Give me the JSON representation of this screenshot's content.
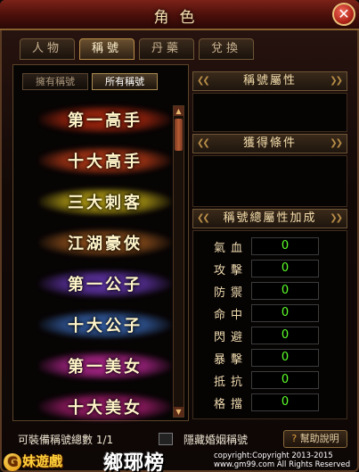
{
  "window": {
    "title": "角色",
    "close_icon": "close-icon"
  },
  "tabs": [
    {
      "label": "人物",
      "active": false
    },
    {
      "label": "稱號",
      "active": true
    },
    {
      "label": "丹藥",
      "active": false
    },
    {
      "label": "兌換",
      "active": false
    }
  ],
  "subtabs": [
    {
      "label": "擁有稱號",
      "active": false
    },
    {
      "label": "所有稱號",
      "active": true
    }
  ],
  "titles": [
    {
      "text": "第一高手",
      "glow": "#b52a10"
    },
    {
      "text": "十大高手",
      "glow": "#c8401a"
    },
    {
      "text": "三大刺客",
      "glow": "#c8b018"
    },
    {
      "text": "江湖豪俠",
      "glow": "#a05a20"
    },
    {
      "text": "第一公子",
      "glow": "#6a3ab8"
    },
    {
      "text": "十大公子",
      "glow": "#3a6ab8"
    },
    {
      "text": "第一美女",
      "glow": "#c02a9a"
    },
    {
      "text": "十大美女",
      "glow": "#b02078"
    }
  ],
  "right": {
    "title_attr_header": "稱號屬性",
    "conditions_header": "獲得條件",
    "total_attr_header": "稱號總屬性加成",
    "attributes": [
      {
        "label": "氣血",
        "value": "0"
      },
      {
        "label": "攻擊",
        "value": "0"
      },
      {
        "label": "防禦",
        "value": "0"
      },
      {
        "label": "命中",
        "value": "0"
      },
      {
        "label": "閃避",
        "value": "0"
      },
      {
        "label": "暴擊",
        "value": "0"
      },
      {
        "label": "抵抗",
        "value": "0"
      },
      {
        "label": "格擋",
        "value": "0"
      }
    ]
  },
  "footer": {
    "equip_count": "可裝備稱號總數 1/1",
    "hide_marriage": "隱藏婚姻稱號",
    "help": "幫助說明"
  },
  "branding": {
    "logo": "妹遊戲",
    "logo_initial": "G",
    "game_logo": "鄉琊榜",
    "copyright_1": "copyright:Copyright 2013-2015",
    "copyright_2": "www.gm99.com All Rights Reserved"
  },
  "colors": {
    "value_green": "#5cff2a",
    "accent_gold": "#b88d48",
    "title_red": "#7b2218"
  }
}
